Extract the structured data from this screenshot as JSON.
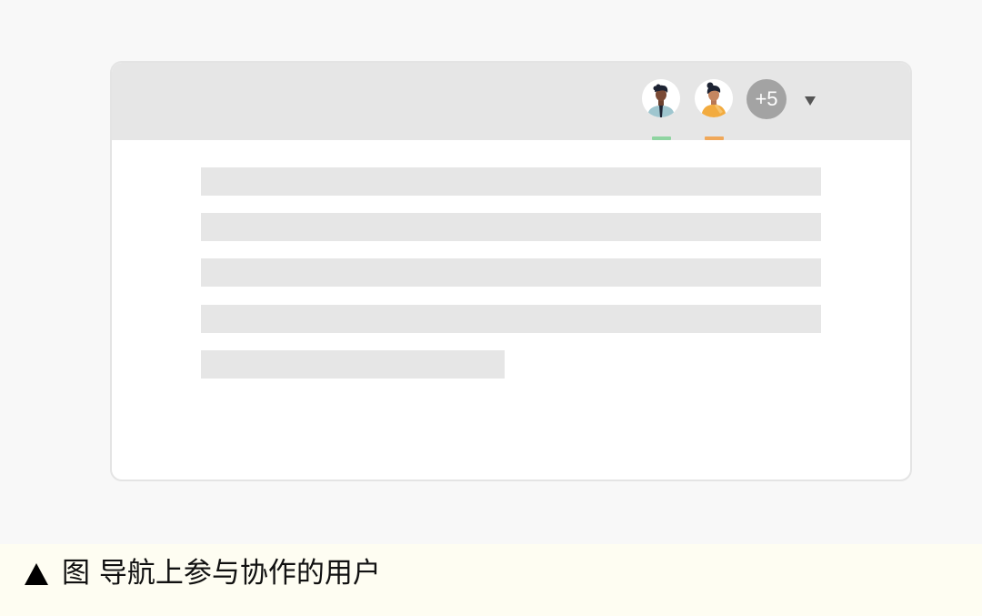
{
  "collaborators": {
    "users": [
      {
        "avatar_icon": "man-avatar-icon",
        "presence_color": "#8fd4a1"
      },
      {
        "avatar_icon": "woman-avatar-icon",
        "presence_color": "#f0a85a"
      }
    ],
    "more_count": "+5",
    "dropdown_icon": "caret-down-icon"
  },
  "caption": {
    "marker_icon": "triangle-up-icon",
    "text": "图 导航上参与协作的用户"
  },
  "colors": {
    "page_background": "#f8f8f8",
    "topbar": "#e6e6e6",
    "placeholder_line": "#e6e6e6",
    "badge": "#a3a3a3",
    "caption_background": "#fefdf2"
  }
}
